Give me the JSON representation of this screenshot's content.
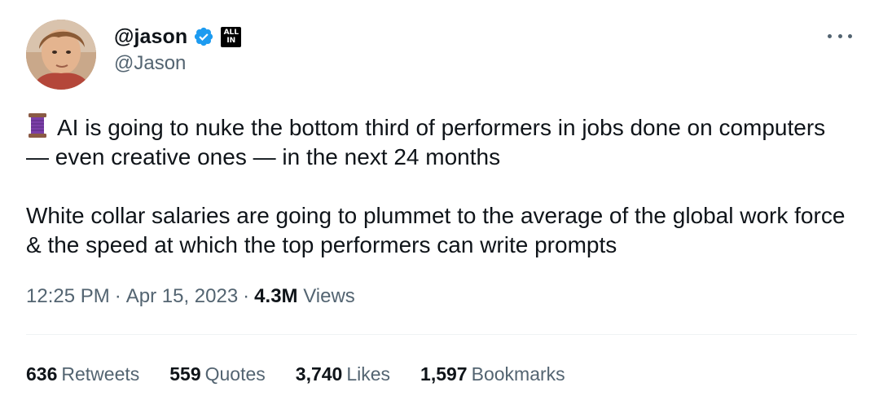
{
  "author": {
    "display_name": "@jason",
    "handle": "@Jason",
    "verified_badge": "verified-badge-icon",
    "affiliate_badge": {
      "line1": "ALL",
      "line2": "IN"
    }
  },
  "more_menu": "more-options-icon",
  "tweet": {
    "emoji": "spool-of-thread-emoji",
    "paragraph1": "AI is going to nuke the bottom third of performers in jobs done on computers — even creative ones — in the next 24 months",
    "paragraph2": "White collar salaries are going to plummet to the average of the global work force & the speed at which the top performers can write prompts"
  },
  "meta": {
    "time": "12:25 PM",
    "date": "Apr 15, 2023",
    "views_count": "4.3M",
    "views_label": "Views",
    "separator": "·"
  },
  "stats": [
    {
      "count": "636",
      "label": "Retweets"
    },
    {
      "count": "559",
      "label": "Quotes"
    },
    {
      "count": "3,740",
      "label": "Likes"
    },
    {
      "count": "1,597",
      "label": "Bookmarks"
    }
  ],
  "colors": {
    "text_primary": "#0f1419",
    "text_secondary": "#536471",
    "verified_blue": "#1d9bf0",
    "divider": "#eff3f4"
  }
}
